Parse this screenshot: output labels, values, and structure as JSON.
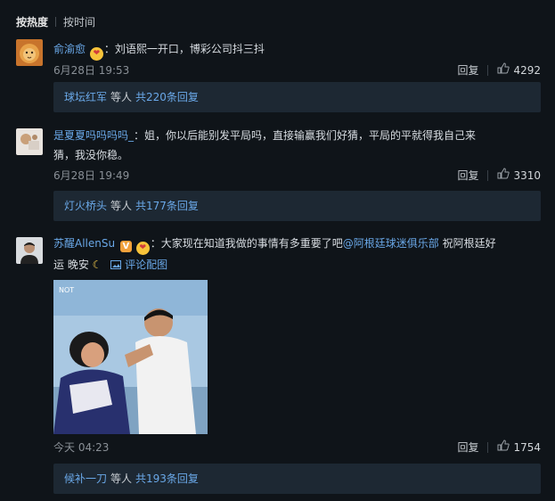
{
  "sort": {
    "hot_label": "按热度",
    "time_label": "按时间"
  },
  "comments": [
    {
      "user": "俞渝愈",
      "emoji": "❤",
      "text": "：刘语熙一开口，博彩公司抖三抖",
      "time": "6月28日 19:53",
      "reply_label": "回复",
      "likes": "4292",
      "reply_summary": {
        "who": "球坛红军",
        "etc": "等人",
        "total": "共220条回复"
      }
    },
    {
      "user": "是夏夏吗吗吗吗_",
      "text_line1": "：姐，你以后能别发平局吗，直接输赢我们好猜，平局的平就得我自己来",
      "text_line2": "猜，我没你稳。",
      "time": "6月28日 19:49",
      "reply_label": "回复",
      "likes": "3310",
      "reply_summary": {
        "who": "灯火桥头",
        "etc": "等人",
        "total": "共177条回复"
      }
    },
    {
      "user": "苏醒AllenSu",
      "badge": "V",
      "emoji": "❤",
      "text_before": "：大家现在知道我做的事情有多重要了吧",
      "mention": "@阿根廷球迷俱乐部",
      "text_after": " 祝阿根廷好",
      "text_line2": "运  晚安",
      "moon": "☾",
      "pic_link": "评论配图",
      "time": "今天 04:23",
      "reply_label": "回复",
      "likes": "1754",
      "reply_summary": {
        "who": "候补一刀",
        "etc": "等人",
        "total": "共193条回复"
      }
    }
  ],
  "icons": {
    "thumb": "thumbs-up-icon",
    "picture": "picture-icon",
    "badge": "verified-badge-icon"
  },
  "colors": {
    "background": "#0f1419",
    "link": "#6aa8e8",
    "reply_box": "#1d2833"
  }
}
